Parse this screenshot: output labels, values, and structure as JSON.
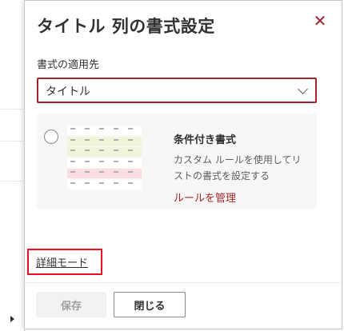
{
  "panel": {
    "title": "タイトル 列の書式設定",
    "close_icon": "close-icon"
  },
  "apply_to": {
    "label": "書式の適用先",
    "selected": "タイトル"
  },
  "conditional": {
    "heading": "条件付き書式",
    "description": "カスタム ルールを使用してリストの書式を設定する",
    "link": "ルールを管理",
    "preview_rows": [
      {
        "color": "#ffffff"
      },
      {
        "color": "#eef5d8"
      },
      {
        "color": "#eef5d8"
      },
      {
        "color": "#ffffff"
      },
      {
        "color": "#fadde1"
      },
      {
        "color": "#ffffff"
      }
    ]
  },
  "advanced_link": "詳細モード",
  "footer": {
    "save_label": "保存",
    "close_label": "閉じる"
  },
  "colors": {
    "accent": "#a4262c",
    "highlight_box": "#e81123"
  }
}
